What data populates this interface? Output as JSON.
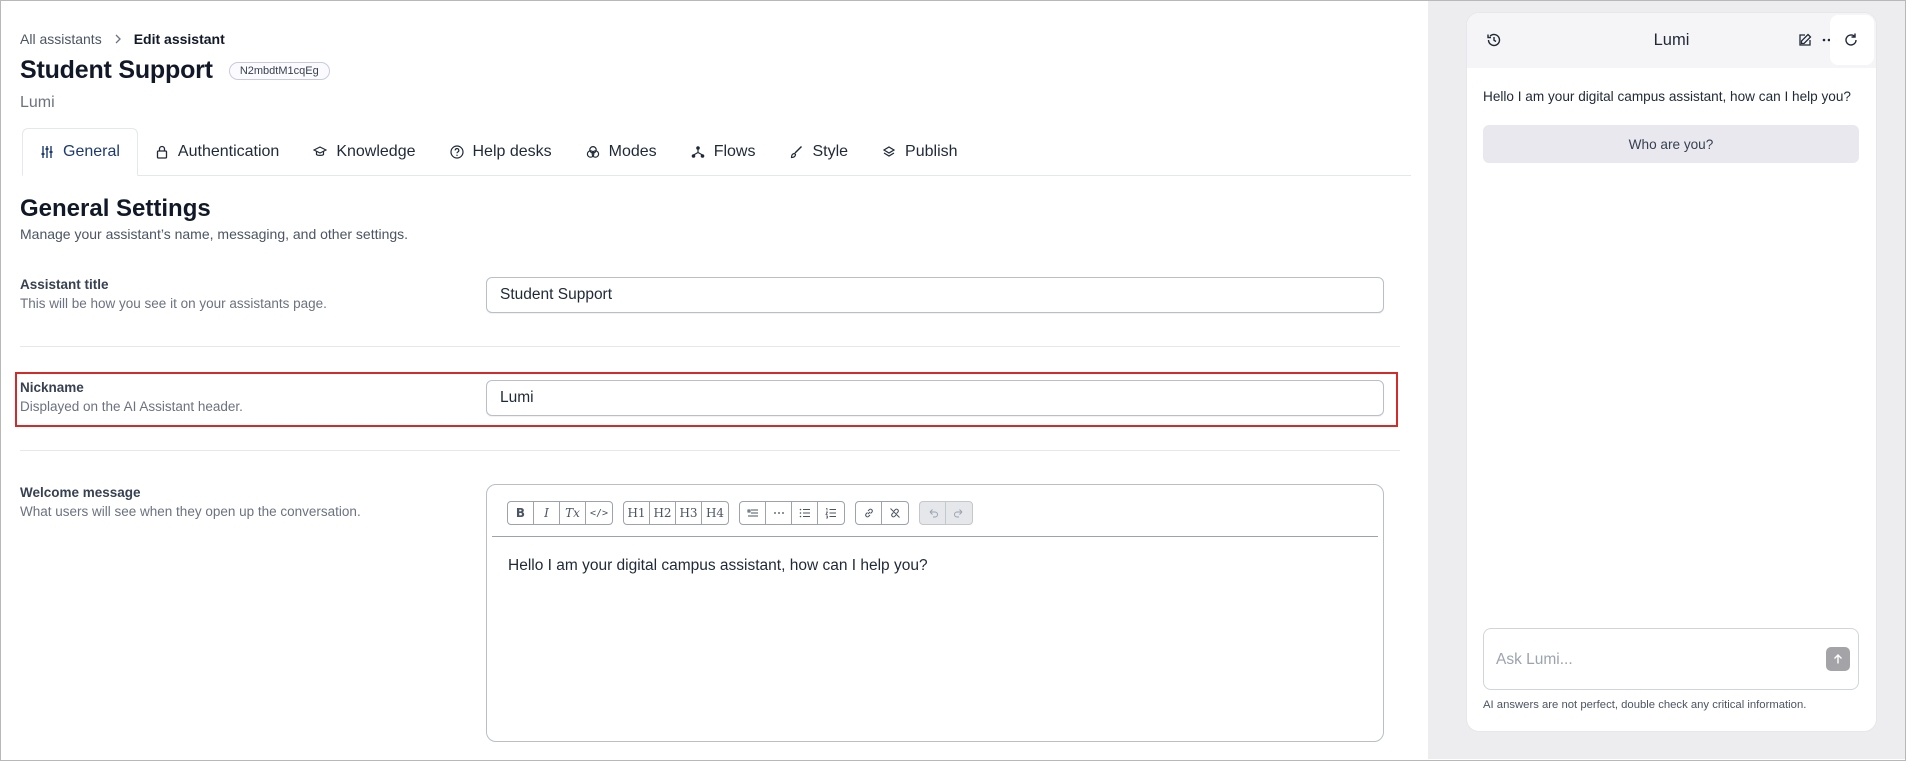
{
  "breadcrumb": {
    "root": "All assistants",
    "current": "Edit assistant"
  },
  "assistant": {
    "title": "Student Support",
    "id": "N2mbdtM1cqEg",
    "nickname": "Lumi"
  },
  "tabs": [
    {
      "label": "General",
      "icon": "sliders-icon",
      "active": true
    },
    {
      "label": "Authentication",
      "icon": "lock-icon"
    },
    {
      "label": "Knowledge",
      "icon": "graduation-cap-icon"
    },
    {
      "label": "Help desks",
      "icon": "question-circle-icon"
    },
    {
      "label": "Modes",
      "icon": "circles-icon"
    },
    {
      "label": "Flows",
      "icon": "flow-icon"
    },
    {
      "label": "Style",
      "icon": "brush-icon"
    },
    {
      "label": "Publish",
      "icon": "stack-icon"
    }
  ],
  "section": {
    "title": "General Settings",
    "description": "Manage your assistant’s name, messaging, and other settings."
  },
  "fields": {
    "title": {
      "label": "Assistant title",
      "help": "This will be how you see it on your assistants page.",
      "value": "Student Support"
    },
    "nickname": {
      "label": "Nickname",
      "help": "Displayed on the AI Assistant header.",
      "value": "Lumi"
    },
    "welcome": {
      "label": "Welcome message",
      "help": "What users will see when they open up the conversation.",
      "content": "Hello I am your digital campus assistant, how can I help you?"
    }
  },
  "toolbar": {
    "format": [
      "B",
      "I",
      "Tx",
      "</>"
    ],
    "headings": [
      "H1",
      "H2",
      "H3",
      "H4"
    ],
    "blocks": [
      "blockquote",
      "horizontal-rule",
      "bullet-list",
      "ordered-list"
    ],
    "links": [
      "link",
      "unlink"
    ],
    "history": [
      "undo",
      "redo"
    ]
  },
  "preview": {
    "title": "Lumi",
    "welcome": "Hello I am your digital campus assistant, how can I help you?",
    "suggestion": "Who are you?",
    "placeholder": "Ask Lumi...",
    "disclaimer": "AI answers are not perfect, double check any critical information."
  },
  "colors": {
    "accent": "#1e3a6e",
    "highlight": "#d42a2a",
    "panel": "#ededf0"
  }
}
